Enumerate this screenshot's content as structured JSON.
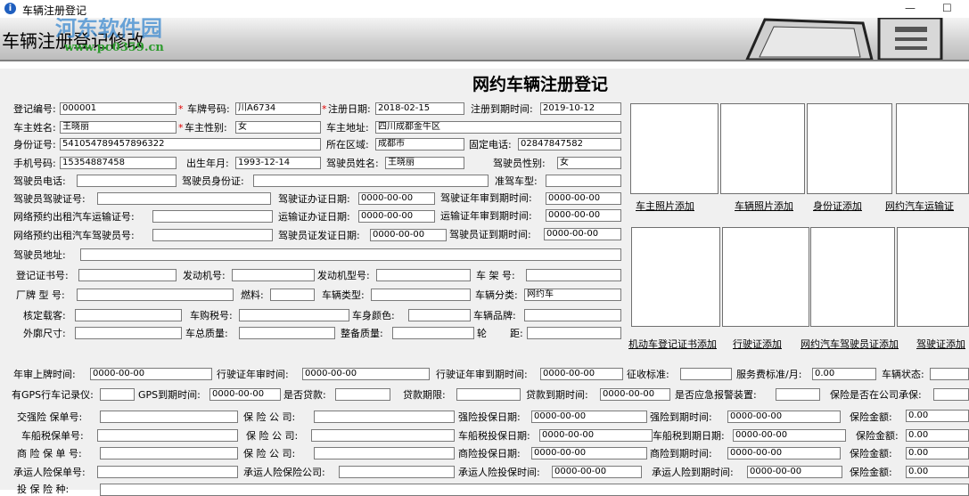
{
  "window": {
    "title": "车辆注册登记",
    "btn_min": "—",
    "btn_max": "☐"
  },
  "banner": {
    "title": "车辆注册登记修改",
    "watermark": "河东软件园",
    "watermark_url": "www.pc0359.cn"
  },
  "form": {
    "heading": "网约车辆注册登记",
    "row1": {
      "reg_no_label": "登记编号:",
      "reg_no": "000001",
      "plate_label": "车牌号码:",
      "plate": "川A6734",
      "reg_date_label": "注册日期:",
      "reg_date": "2018-02-15",
      "expire_label": "注册到期时间:",
      "expire": "2019-10-12"
    },
    "row2": {
      "owner_label": "车主姓名:",
      "owner": "王晓丽",
      "gender_label": "车主性别:",
      "gender": "女",
      "addr_label": "车主地址:",
      "addr": "四川成都金牛区"
    },
    "row3": {
      "id_label": "身份证号:",
      "id": "541054789457896322",
      "region_label": "所在区域:",
      "region": "成都市",
      "phone_label": "固定电话:",
      "phone": "02847847582"
    },
    "row4": {
      "mobile_label": "手机号码:",
      "mobile": "15354887458",
      "birth_label": "出生年月:",
      "birth": "1993-12-14",
      "driver_name_label": "驾驶员姓名:",
      "driver_name": "王晓丽",
      "driver_gender_label": "驾驶员性别:",
      "driver_gender": "女"
    },
    "row5": {
      "driver_phone_label": "驾驶员电话:",
      "driver_id_label": "驾驶员身份证:",
      "class_label": "准驾车型:"
    },
    "row6": {
      "license_label": "驾驶员驾驶证号:",
      "issue_label": "驾驶证办证日期:",
      "issue": "0000-00-00",
      "annual_label": "驾驶证年审到期时间:",
      "annual": "0000-00-00"
    },
    "row7": {
      "transport_label": "网络预约出租汽车运输证号:",
      "t_issue_label": "运输证办证日期:",
      "t_issue": "0000-00-00",
      "t_annual_label": "运输证年审到期时间:",
      "t_annual": "0000-00-00"
    },
    "row8": {
      "driver_cert_label": "网络预约出租汽车驾驶员号:",
      "c_issue_label": "驾驶员证发证日期:",
      "c_issue": "0000-00-00",
      "c_expire_label": "驾驶员证到期时间:",
      "c_expire": "0000-00-00"
    },
    "row9": {
      "driver_addr_label": "驾驶员地址:"
    },
    "row10": {
      "cert_label": "登记证书号:",
      "engine_label": "发动机号:",
      "engine_model_label": "发动机型号:",
      "frame_label": "车 架 号:"
    },
    "row11": {
      "brand_label": "厂牌 型 号:",
      "fuel_label": "燃料:",
      "type_label": "车辆类型:",
      "cat_label": "车辆分类:",
      "cat": "网约车"
    },
    "row12": {
      "seats_label": "核定载客:",
      "tax_label": "车购税号:",
      "color_label": "车身颜色:",
      "vbrand_label": "车辆品牌:"
    },
    "row13": {
      "size_label": "外廓尺寸:",
      "weight_label": "车总质量:",
      "curb_label": "整备质量:",
      "wheel_label": "轮",
      "dist_label": "距:"
    },
    "photos_top": [
      "车主照片添加",
      "车辆照片添加",
      "身份证添加",
      "网约汽车运输证"
    ],
    "photos_bottom": [
      "机动车登记证书添加",
      "行驶证添加",
      "网约汽车驾驶员证添加",
      "驾驶证添加"
    ],
    "row14": {
      "plate_on_label": "年审上牌时间:",
      "plate_on": "0000-00-00",
      "lic_annual_label": "行驶证年审时间:",
      "lic_annual": "0000-00-00",
      "lic_exp_label": "行驶证年审到期时间:",
      "lic_exp": "0000-00-00",
      "fee_std_label": "征收标准:",
      "svc_fee_label": "服务费标准/月:",
      "svc_fee": "0.00",
      "status_label": "车辆状态:"
    },
    "row15": {
      "gps_label": "有GPS行车记录仪:",
      "gps_exp_label": "GPS到期时间:",
      "gps_exp": "0000-00-00",
      "loan_label": "是否贷款:",
      "loan_term_label": "贷款期限:",
      "loan_exp_label": "贷款到期时间:",
      "loan_exp": "0000-00-00",
      "alarm_label": "是否应急报警装置:",
      "ins_co_label": "保险是否在公司承保:"
    },
    "ins_rows": [
      {
        "no_label": "交强险 保单号:",
        "co_label": "保 险 公 司:",
        "start_label": "强险投保日期:",
        "start": "0000-00-00",
        "end_label": "强险到期时间:",
        "end": "0000-00-00",
        "amt_label": "保险金额:",
        "amt": "0.00"
      },
      {
        "no_label": "车船税保单号:",
        "co_label": "保 险 公 司:",
        "start_label": "车船税投保日期:",
        "start": "0000-00-00",
        "end_label": "车船税到期日期:",
        "end": "0000-00-00",
        "amt_label": "保险金额:",
        "amt": "0.00"
      },
      {
        "no_label": "商 险 保 单 号:",
        "co_label": "保 险 公 司:",
        "start_label": "商险投保日期:",
        "start": "0000-00-00",
        "end_label": "商险到期时间:",
        "end": "0000-00-00",
        "amt_label": "保险金额:",
        "amt": "0.00"
      },
      {
        "no_label": "承运人险保单号:",
        "co_label": "承运人险保险公司:",
        "start_label": "承运人险投保时间:",
        "start": "0000-00-00",
        "end_label": "承运人险到期时间:",
        "end": "0000-00-00",
        "amt_label": "保险金额:",
        "amt": "0.00"
      }
    ],
    "last_label": "投 保 险 种:"
  }
}
